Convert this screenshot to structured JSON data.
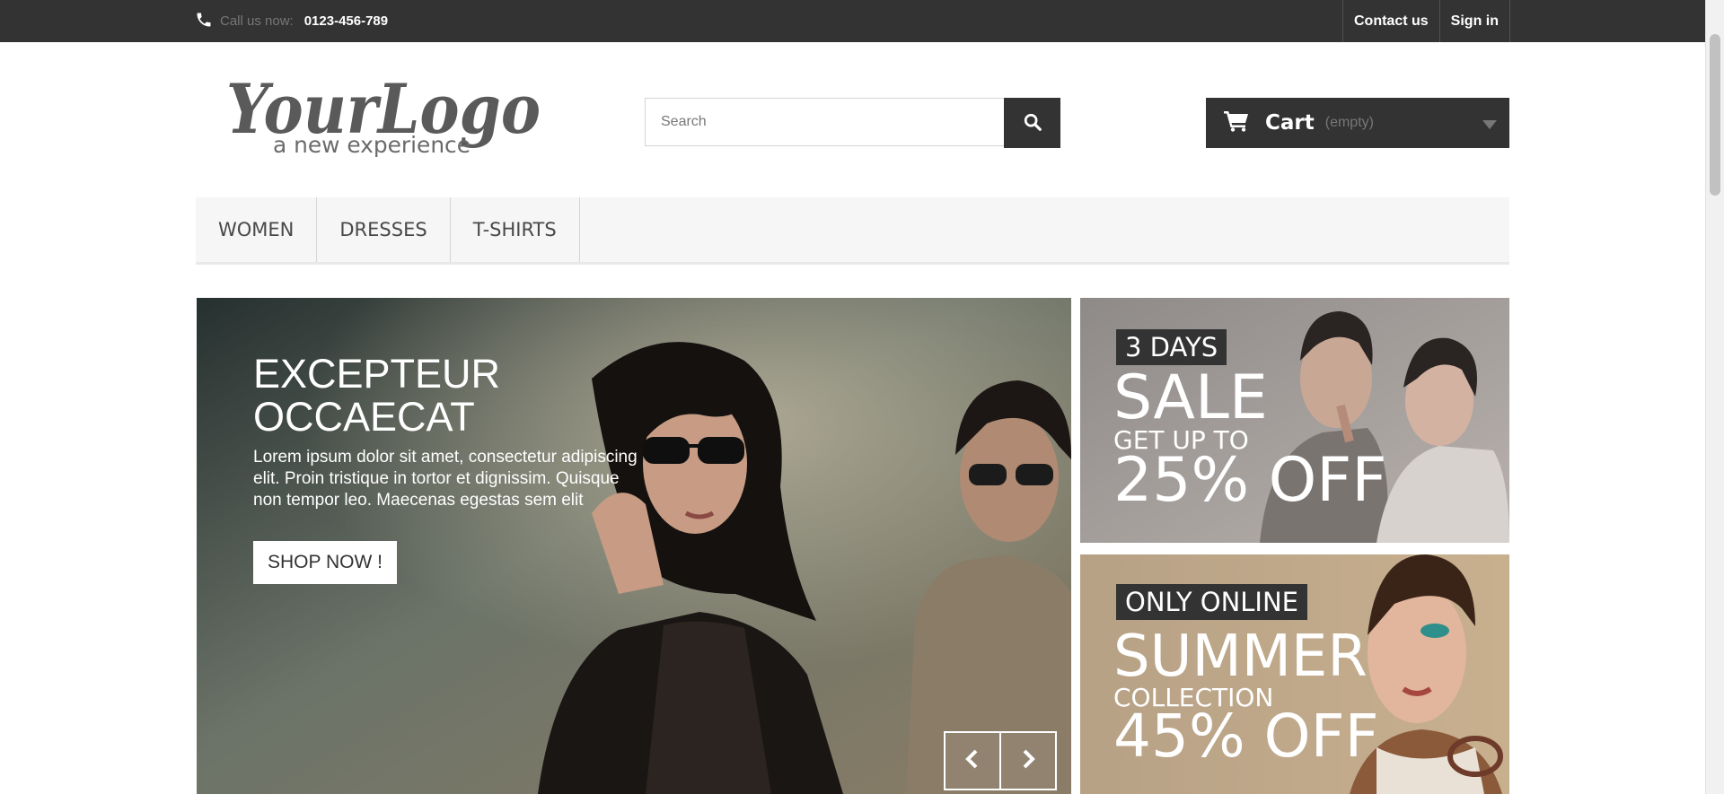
{
  "topbar": {
    "call_label": "Call us now:",
    "phone": "0123-456-789",
    "links": [
      "Contact us",
      "Sign in"
    ]
  },
  "logo": {
    "line1": "YourLogo",
    "line2": "a new experience"
  },
  "search": {
    "placeholder": "Search",
    "value": ""
  },
  "cart": {
    "label": "Cart",
    "status": "(empty)"
  },
  "menu": {
    "items": [
      "Women",
      "Dresses",
      "T-shirts"
    ]
  },
  "slider": {
    "title": "EXCEPTEUR OCCAECAT",
    "text": "Lorem ipsum dolor sit amet, consectetur adipiscing elit. Proin tristique in tortor et dignissim. Quisque non tempor leo. Maecenas egestas sem elit",
    "button": "SHOP NOW !"
  },
  "banners": [
    {
      "tag": "3 DAYS",
      "big": "SALE",
      "sub": "GET UP TO",
      "offer": "25% OFF"
    },
    {
      "tag": "ONLY ONLINE",
      "big": "SUMMER",
      "sub": "COLLECTION",
      "offer": "45% OFF"
    }
  ],
  "colors": {
    "topbar": "#333333",
    "menu_bg": "#f6f6f6",
    "cart_bg": "#333333",
    "muted": "#777777"
  },
  "icons": [
    "phone-icon",
    "search-icon",
    "cart-icon",
    "caret-down-icon",
    "chevron-left-icon",
    "chevron-right-icon"
  ]
}
